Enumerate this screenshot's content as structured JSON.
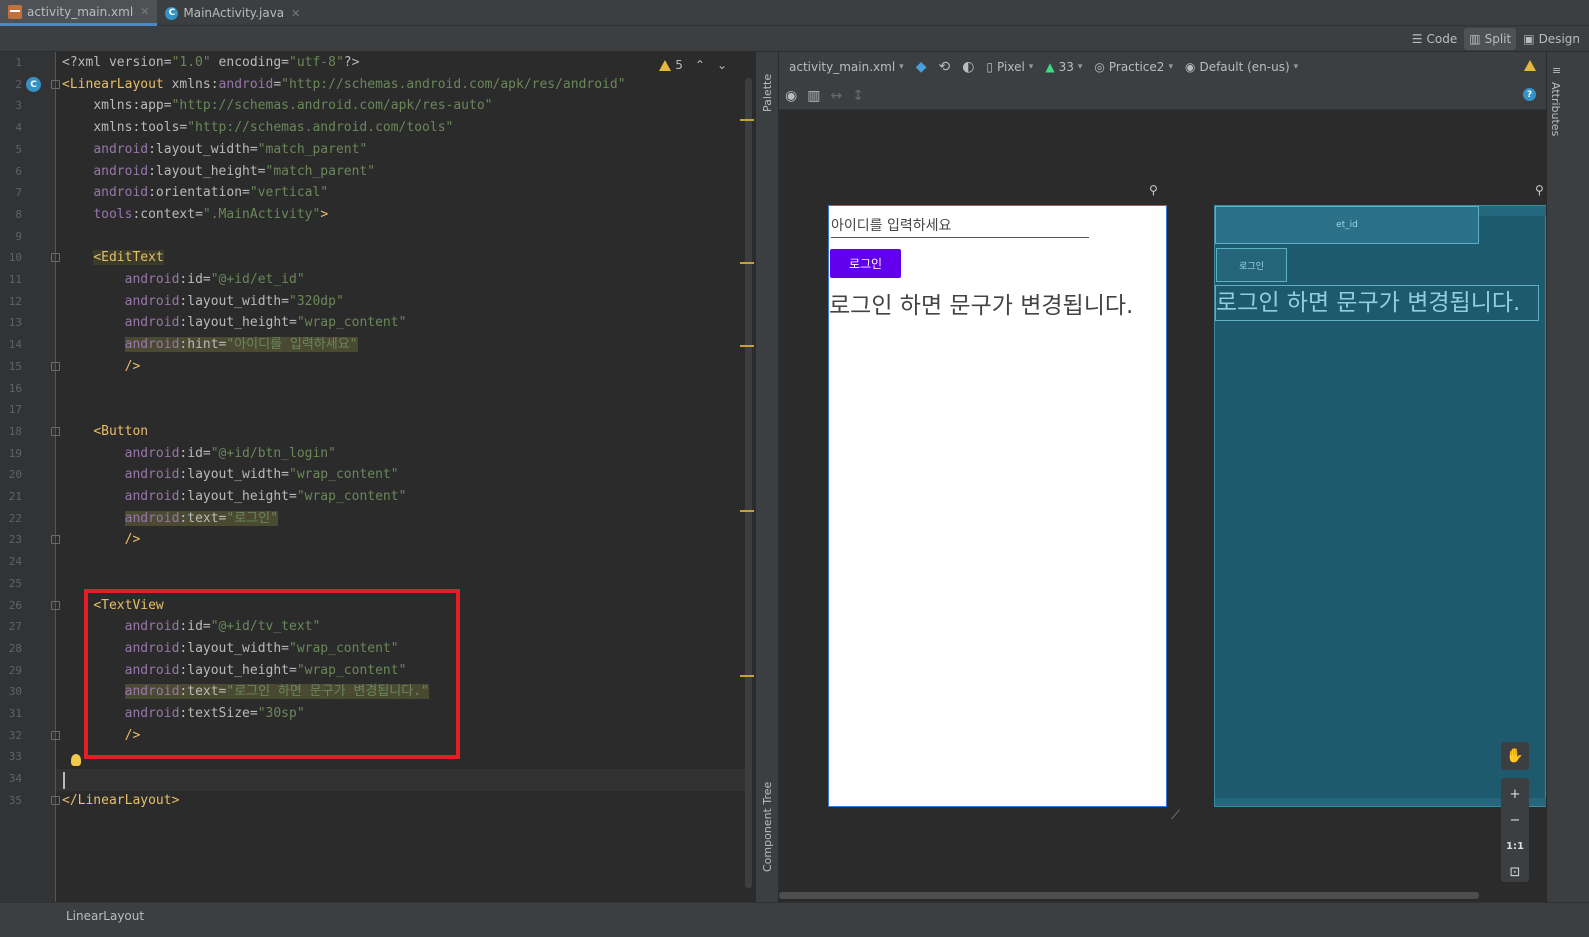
{
  "tabs": [
    {
      "label": "activity_main.xml",
      "active": true
    },
    {
      "label": "MainActivity.java",
      "active": false
    }
  ],
  "view_modes": {
    "code": "Code",
    "split": "Split",
    "design": "Design"
  },
  "editor": {
    "warning_count": "5",
    "lines": [
      {
        "n": "1",
        "html": "<span class='a'>&lt;?xml version=</span><span class='v'>\"1.0\"</span><span class='a'> encoding=</span><span class='v'>\"utf-8\"</span><span class='a'>?&gt;</span>"
      },
      {
        "n": "2",
        "html": "<span class='t'>&lt;LinearLayout </span><span class='a'>xmlns:</span><span class='ns'>android</span><span class='a'>=</span><span class='v'>\"http://schemas.android.com/apk/res/android\"</span>"
      },
      {
        "n": "3",
        "html": "    <span class='a'>xmlns:app=</span><span class='v'>\"http://schemas.android.com/apk/res-auto\"</span>"
      },
      {
        "n": "4",
        "html": "    <span class='a'>xmlns:tools=</span><span class='v'>\"http://schemas.android.com/tools\"</span>"
      },
      {
        "n": "5",
        "html": "    <span class='ns'>android</span><span class='a'>:layout_width=</span><span class='v'>\"match_parent\"</span>"
      },
      {
        "n": "6",
        "html": "    <span class='ns'>android</span><span class='a'>:layout_height=</span><span class='v'>\"match_parent\"</span>"
      },
      {
        "n": "7",
        "html": "    <span class='ns'>android</span><span class='a'>:orientation=</span><span class='v'>\"vertical\"</span>"
      },
      {
        "n": "8",
        "html": "    <span class='ns'>tools</span><span class='a'>:context=</span><span class='v'>\".MainActivity\"</span><span class='t'>&gt;</span>"
      },
      {
        "n": "9",
        "html": ""
      },
      {
        "n": "10",
        "html": "    <span class='t tagbg'>&lt;EditText</span>"
      },
      {
        "n": "11",
        "html": "        <span class='ns'>android</span><span class='a'>:id=</span><span class='v'>\"@+id/et_id\"</span>"
      },
      {
        "n": "12",
        "html": "        <span class='ns'>android</span><span class='a'>:layout_width=</span><span class='v'>\"320dp\"</span>"
      },
      {
        "n": "13",
        "html": "        <span class='ns'>android</span><span class='a'>:layout_height=</span><span class='v'>\"wrap_content\"</span>"
      },
      {
        "n": "14",
        "html": "        <span class='hl'><span class='ns'>android</span><span class='a'>:hint=</span><span class='v'>\"아이디를 입력하세요\"</span></span>"
      },
      {
        "n": "15",
        "html": "        <span class='t'>/&gt;</span>"
      },
      {
        "n": "16",
        "html": ""
      },
      {
        "n": "17",
        "html": ""
      },
      {
        "n": "18",
        "html": "    <span class='t'>&lt;Button</span>"
      },
      {
        "n": "19",
        "html": "        <span class='ns'>android</span><span class='a'>:id=</span><span class='v'>\"@+id/btn_login\"</span>"
      },
      {
        "n": "20",
        "html": "        <span class='ns'>android</span><span class='a'>:layout_width=</span><span class='v'>\"wrap_content\"</span>"
      },
      {
        "n": "21",
        "html": "        <span class='ns'>android</span><span class='a'>:layout_height=</span><span class='v'>\"wrap_content\"</span>"
      },
      {
        "n": "22",
        "html": "        <span class='hl'><span class='ns'>android</span><span class='a'>:text=</span><span class='v'>\"로그인\"</span></span>"
      },
      {
        "n": "23",
        "html": "        <span class='t'>/&gt;</span>"
      },
      {
        "n": "24",
        "html": ""
      },
      {
        "n": "25",
        "html": ""
      },
      {
        "n": "26",
        "html": "    <span class='t'>&lt;TextView</span>"
      },
      {
        "n": "27",
        "html": "        <span class='ns'>android</span><span class='a'>:id=</span><span class='v'>\"@+id/tv_text\"</span>"
      },
      {
        "n": "28",
        "html": "        <span class='ns'>android</span><span class='a'>:layout_width=</span><span class='v'>\"wrap_content\"</span>"
      },
      {
        "n": "29",
        "html": "        <span class='ns'>android</span><span class='a'>:layout_height=</span><span class='v'>\"wrap_content\"</span>"
      },
      {
        "n": "30",
        "html": "        <span class='hl'><span class='ns'>android</span><span class='a'>:text=</span><span class='v'>\"로그인 하면 문구가 변경됩니다.\"</span></span>"
      },
      {
        "n": "31",
        "html": "        <span class='ns'>android</span><span class='a'>:textSize=</span><span class='v'>\"30sp\"</span>"
      },
      {
        "n": "32",
        "html": "        <span class='t'>/&gt;</span>"
      },
      {
        "n": "33",
        "html": ""
      },
      {
        "n": "34",
        "html": ""
      },
      {
        "n": "35",
        "html": "<span class='t'>&lt;/LinearLayout&gt;</span>"
      }
    ]
  },
  "side_panels": {
    "palette": "Palette",
    "component_tree": "Component Tree",
    "attributes": "Attributes"
  },
  "design_toolbar": {
    "file": "activity_main.xml",
    "device": "Pixel",
    "api": "33",
    "theme": "Practice2",
    "locale": "Default (en-us)"
  },
  "preview": {
    "hint": "아이디를 입력하세요",
    "button": "로그인",
    "text": "로그인 하면 문구가 변경됩니다."
  },
  "blueprint": {
    "edit_id": "et_id",
    "button": "로그인",
    "text": "로그인 하면 문구가 변경됩니다."
  },
  "zoom": {
    "plus": "+",
    "minus": "−",
    "one_to_one": "1:1"
  },
  "status": {
    "breadcrumb": "LinearLayout"
  }
}
